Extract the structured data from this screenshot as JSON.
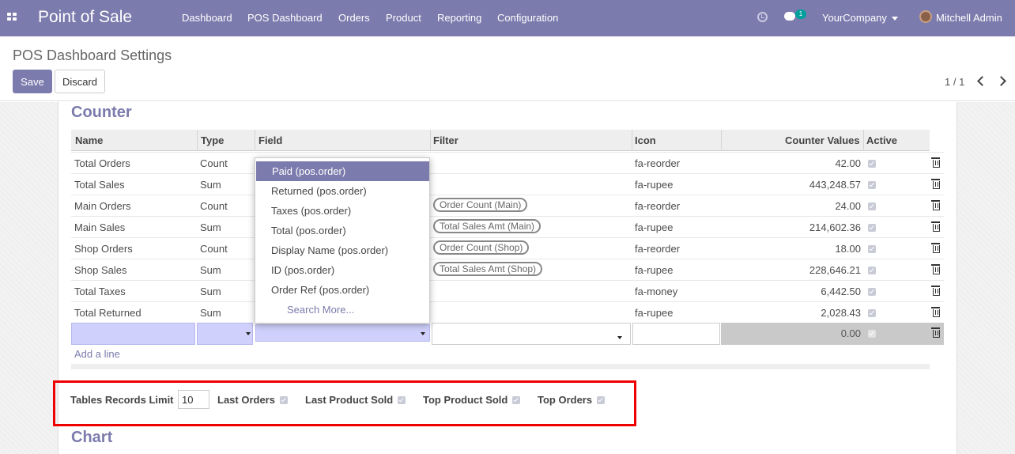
{
  "topbar": {
    "app_title": "Point of Sale",
    "menu": [
      "Dashboard",
      "POS Dashboard",
      "Orders",
      "Product",
      "Reporting",
      "Configuration"
    ],
    "message_count": "1",
    "company": "YourCompany",
    "user": "Mitchell Admin"
  },
  "control_panel": {
    "title": "POS Dashboard Settings",
    "save_label": "Save",
    "discard_label": "Discard",
    "pager": "1 / 1"
  },
  "counter": {
    "heading": "Counter",
    "columns": [
      "Name",
      "Type",
      "Field",
      "Filter",
      "Icon",
      "Counter Values",
      "Active"
    ],
    "rows": [
      {
        "name": "Total Orders",
        "type": "Count",
        "filter": "",
        "icon": "fa-reorder",
        "value": "42.00",
        "active": true
      },
      {
        "name": "Total Sales",
        "type": "Sum",
        "filter": "",
        "icon": "fa-rupee",
        "value": "443,248.57",
        "active": true
      },
      {
        "name": "Main Orders",
        "type": "Count",
        "filter": "Order Count (Main)",
        "icon": "fa-reorder",
        "value": "24.00",
        "active": true
      },
      {
        "name": "Main Sales",
        "type": "Sum",
        "filter": "Total Sales Amt (Main)",
        "icon": "fa-rupee",
        "value": "214,602.36",
        "active": true
      },
      {
        "name": "Shop Orders",
        "type": "Count",
        "filter": "Order Count (Shop)",
        "icon": "fa-reorder",
        "value": "18.00",
        "active": true
      },
      {
        "name": "Shop Sales",
        "type": "Sum",
        "filter": "Total Sales Amt (Shop)",
        "icon": "fa-rupee",
        "value": "228,646.21",
        "active": true
      },
      {
        "name": "Total Taxes",
        "type": "Sum",
        "filter": "",
        "icon": "fa-money",
        "value": "6,442.50",
        "active": true
      },
      {
        "name": "Total Returned",
        "type": "Sum",
        "filter": "",
        "icon": "fa-rupee",
        "value": "2,028.43",
        "active": true
      }
    ],
    "new_row_value": "0.00",
    "add_line": "Add a line"
  },
  "field_dropdown": {
    "options": [
      "Paid (pos.order)",
      "Returned (pos.order)",
      "Taxes (pos.order)",
      "Total (pos.order)",
      "Display Name (pos.order)",
      "ID (pos.order)",
      "Order Ref (pos.order)"
    ],
    "selected_index": 0,
    "search_more": "Search More..."
  },
  "options_panel": {
    "tables_limit_label": "Tables Records Limit",
    "tables_limit_value": "10",
    "last_orders_label": "Last Orders",
    "last_product_sold_label": "Last Product Sold",
    "top_product_sold_label": "Top Product Sold",
    "top_orders_label": "Top Orders",
    "last_orders": true,
    "last_product_sold": true,
    "top_product_sold": true,
    "top_orders": true
  },
  "chart_section": {
    "heading": "Chart"
  },
  "colors": {
    "brand": "#7c7bad",
    "highlight_border": "#ee0000",
    "new_row_input": "#cfd0fb"
  }
}
